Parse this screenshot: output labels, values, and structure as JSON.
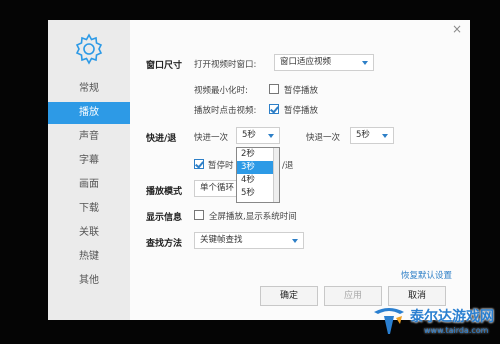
{
  "sidebar": {
    "items": [
      {
        "label": "常规"
      },
      {
        "label": "播放"
      },
      {
        "label": "声音"
      },
      {
        "label": "字幕"
      },
      {
        "label": "画面"
      },
      {
        "label": "下载"
      },
      {
        "label": "关联"
      },
      {
        "label": "热键"
      },
      {
        "label": "其他"
      }
    ],
    "active_index": 1,
    "icon": "gear-icon"
  },
  "window": {
    "close_glyph": "×",
    "accent": "#2d9ae6"
  },
  "window_size": {
    "section": "窗口尺寸",
    "open_label": "打开视频时窗口:",
    "open_value": "窗口适应视频",
    "minimize_label": "视频最小化时:",
    "minimize_option": "暂停播放",
    "minimize_checked": false,
    "click_label": "播放时点击视频:",
    "click_option": "暂停播放",
    "click_checked": true
  },
  "seek": {
    "section": "快进/退",
    "forward_label": "快进一次",
    "forward_value": "5秒",
    "backward_label": "快退一次",
    "backward_value": "5秒",
    "dropdown_options": [
      "2秒",
      "3秒",
      "4秒",
      "5秒"
    ],
    "dropdown_selected_index": 1,
    "pause_option_visible_start": "暂停时",
    "pause_option_visible_end": "/退",
    "pause_checked": true
  },
  "play_mode": {
    "section": "播放模式",
    "value_visible": "单个循环"
  },
  "display_info": {
    "section": "显示信息",
    "option": "全屏播放,显示系统时间",
    "checked": false
  },
  "search_method": {
    "section": "查找方法",
    "value": "关键帧查找"
  },
  "footer": {
    "restore_link": "恢复默认设置",
    "ok_label": "确定",
    "apply_label": "应用",
    "cancel_visible": "取消"
  },
  "watermark": {
    "title": "泰尔达游戏网",
    "url": "www.tairda.com"
  }
}
